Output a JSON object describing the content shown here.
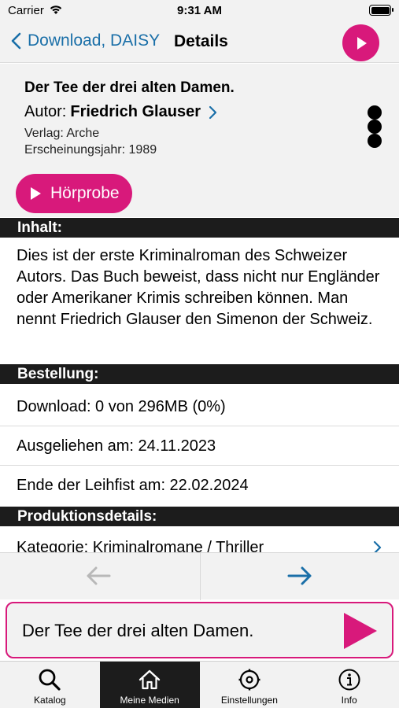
{
  "status_bar": {
    "carrier": "Carrier",
    "time": "9:31 AM"
  },
  "nav": {
    "back_label": "Download, DAISY",
    "title": "Details"
  },
  "book": {
    "title": "Der Tee der drei alten Damen.",
    "author_label": "Autor:",
    "author_name": "Friedrich Glauser",
    "publisher": "Verlag: Arche",
    "year": "Erscheinungsjahr: 1989",
    "sample_button": "Hörprobe"
  },
  "sections": {
    "content_header": "Inhalt:",
    "content_text": "Dies ist der erste Kriminalroman des Schweizer Autors. Das Buch beweist, dass nicht nur Engländer oder Amerikaner Krimis schreiben können. Man nennt Friedrich Glauser den Simenon der Schweiz.",
    "order_header": "Bestellung:",
    "production_header": "Produktionsdetails:"
  },
  "order": {
    "download": "Download: 0 von 296MB (0%)",
    "borrowed": "Ausgeliehen am: 24.11.2023",
    "loan_end": "Ende der Leihfist am: 22.02.2024"
  },
  "production": {
    "category": "Kategorie: Kriminalromane / Thriller"
  },
  "player": {
    "title": "Der Tee der drei alten Damen."
  },
  "tabs": [
    {
      "label": "Katalog",
      "icon": "search-icon"
    },
    {
      "label": "Meine Medien",
      "icon": "home-icon"
    },
    {
      "label": "Einstellungen",
      "icon": "gear-icon"
    },
    {
      "label": "Info",
      "icon": "info-icon"
    }
  ],
  "colors": {
    "accent": "#d8197b",
    "link": "#1a6fa8",
    "header_dark": "#1c1c1c",
    "light_bg": "#f2f2f2"
  }
}
